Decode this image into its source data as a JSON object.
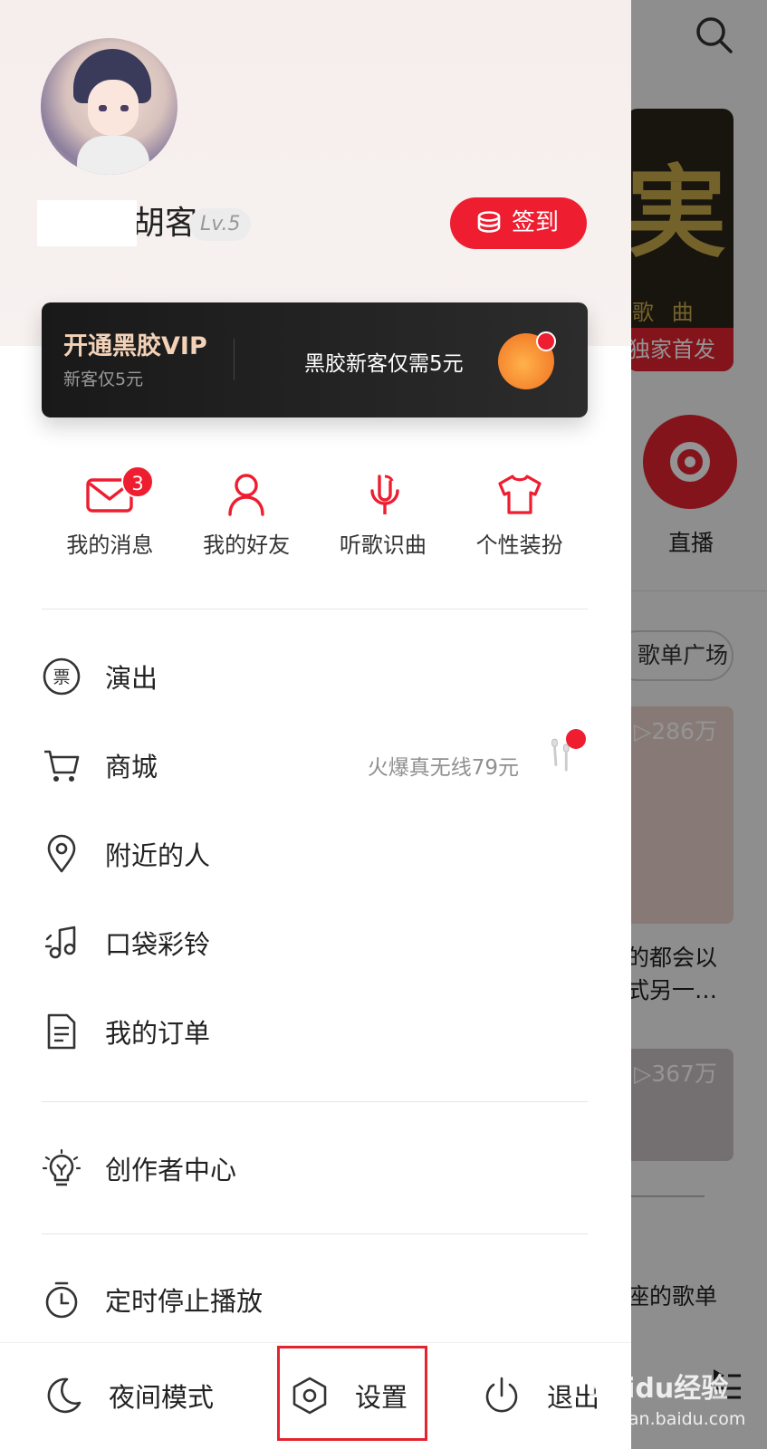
{
  "profile": {
    "username": "胡客",
    "level": "Lv.5",
    "signin_label": "签到"
  },
  "vip": {
    "title": "开通黑胶VIP",
    "subtitle": "新客仅5元",
    "promo": "黑胶新客仅需5元"
  },
  "quick_actions": [
    {
      "label": "我的消息",
      "icon": "mail-icon",
      "badge": "3"
    },
    {
      "label": "我的好友",
      "icon": "person-icon"
    },
    {
      "label": "听歌识曲",
      "icon": "microphone-icon"
    },
    {
      "label": "个性装扮",
      "icon": "tshirt-icon"
    }
  ],
  "menu": [
    {
      "label": "演出",
      "icon": "ticket-icon"
    },
    {
      "label": "商城",
      "icon": "cart-icon",
      "extra": "火爆真无线79元"
    },
    {
      "label": "附近的人",
      "icon": "location-pin-icon"
    },
    {
      "label": "口袋彩铃",
      "icon": "music-note-icon"
    },
    {
      "label": "我的订单",
      "icon": "document-icon"
    },
    {
      "label": "创作者中心",
      "icon": "lightbulb-icon"
    },
    {
      "label": "定时停止播放",
      "icon": "timer-icon"
    }
  ],
  "bottom_bar": {
    "night_mode": "夜间模式",
    "settings": "设置",
    "logout": "退出"
  },
  "background": {
    "banner_subtitle": "歌 曲",
    "banner_tag": "独家首发",
    "live_label": "直播",
    "playlist_pill": "歌单广场",
    "card1_plays": "▷286万",
    "card1_caption_line1": "的都会以",
    "card1_caption_line2": "式另一…",
    "card2_plays": "▷367万",
    "caption2": "座的歌单"
  },
  "watermark": {
    "text": "Baidu经验",
    "url": "jingyan.baidu.com"
  },
  "colors": {
    "accent": "#ee1d30",
    "vip_gold": "#f3d2b8",
    "highlight_box": "#e3242f"
  }
}
